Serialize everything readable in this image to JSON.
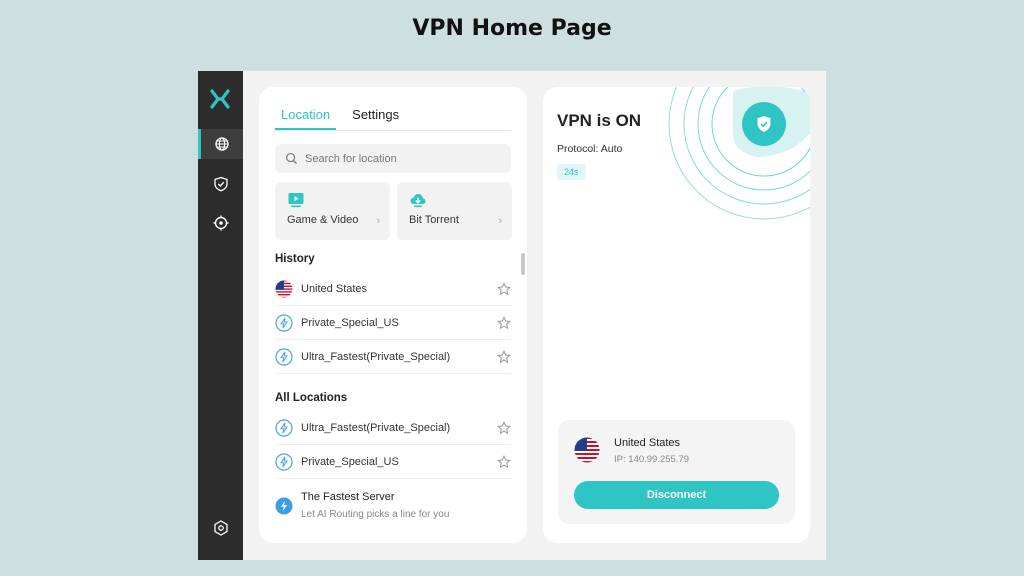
{
  "page_title": "VPN Home Page",
  "colors": {
    "accent": "#2ec5c4",
    "sidebar_bg": "#2c2c2c",
    "page_bg": "#cde0df",
    "app_bg": "#f2f2f2"
  },
  "sidebar": {
    "items": [
      {
        "icon": "globe-icon",
        "active": true
      },
      {
        "icon": "shield-check-icon",
        "active": false
      },
      {
        "icon": "crosshair-icon",
        "active": false
      }
    ],
    "bottom_icon": "settings-hexagon-icon"
  },
  "tabs": [
    {
      "label": "Location",
      "active": true
    },
    {
      "label": "Settings",
      "active": false
    }
  ],
  "search": {
    "placeholder": "Search for location",
    "value": ""
  },
  "categories": [
    {
      "label": "Game & Video",
      "icon": "tv-play-icon"
    },
    {
      "label": "Bit Torrent",
      "icon": "cloud-download-icon"
    }
  ],
  "history": {
    "title": "History",
    "items": [
      {
        "label": "United States",
        "icon": "us-flag-icon"
      },
      {
        "label": "Private_Special_US",
        "icon": "lightning-icon"
      },
      {
        "label": "Ultra_Fastest(Private_Special)",
        "icon": "lightning-icon"
      }
    ]
  },
  "all_locations": {
    "title": "All Locations",
    "items": [
      {
        "label": "Ultra_Fastest(Private_Special)",
        "icon": "lightning-icon"
      },
      {
        "label": "Private_Special_US",
        "icon": "lightning-icon"
      }
    ],
    "fastest": {
      "title": "The Fastest Server",
      "subtitle": "Let AI Routing picks a line for you",
      "icon": "lightning-filled-icon"
    }
  },
  "status": {
    "title": "VPN is ON",
    "protocol": "Protocol: Auto",
    "timer": "24s"
  },
  "connection": {
    "country": "United States",
    "ip": "IP: 140.99.255.79",
    "button_label": "Disconnect"
  }
}
